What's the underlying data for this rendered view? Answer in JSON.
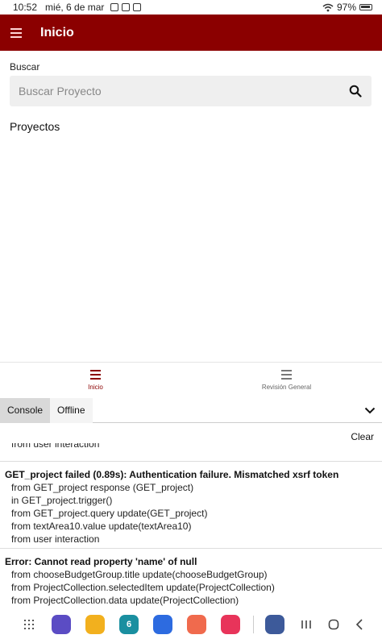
{
  "status_bar": {
    "time": "10:52",
    "date": "mié, 6 de mar",
    "battery": "97%"
  },
  "app_bar": {
    "title": "Inicio",
    "color": "#8b0000"
  },
  "search": {
    "label": "Buscar",
    "placeholder": "Buscar Proyecto",
    "value": ""
  },
  "projects": {
    "heading": "Proyectos",
    "items": []
  },
  "bottom_nav": {
    "items": [
      {
        "label": "Inicio",
        "icon": "menu-icon",
        "active": true
      },
      {
        "label": "Revisión General",
        "icon": "menu-icon",
        "active": false
      }
    ]
  },
  "console": {
    "tabs": [
      "Console",
      "Offline"
    ],
    "active_tab": "Console",
    "clear_label": "Clear",
    "truncated_line": "from user interaction",
    "entries": [
      {
        "head": "GET_project failed (0.89s): Authentication failure. Mismatched xsrf token",
        "lines": [
          "from GET_project response (GET_project)",
          "in GET_project.trigger()",
          "from GET_project.query update(GET_project)",
          "from textArea10.value update(textArea10)",
          "from user interaction"
        ]
      },
      {
        "head": "Error: Cannot read property 'name' of null",
        "lines": [
          "from chooseBudgetGroup.title update(chooseBudgetGroup)",
          "from ProjectCollection.selectedItem update(ProjectCollection)",
          "from ProjectCollection.data update(ProjectCollection)"
        ]
      }
    ]
  },
  "system_nav": {
    "dock_apps": [
      {
        "name": "internet-app-icon",
        "color": "#5b4cc4",
        "label": ""
      },
      {
        "name": "files-app-icon",
        "color": "#f2b01e",
        "label": ""
      },
      {
        "name": "calendar-app-icon",
        "color": "#1a8fa0",
        "label": "6"
      },
      {
        "name": "messages-app-icon",
        "color": "#2d6be0",
        "label": ""
      },
      {
        "name": "contacts-app-icon",
        "color": "#f06a4d",
        "label": ""
      },
      {
        "name": "screen-recorder-app-icon",
        "color": "#e8345a",
        "label": ""
      },
      {
        "name": "settings-app-icon",
        "color": "#3d5a9a",
        "label": ""
      }
    ]
  }
}
